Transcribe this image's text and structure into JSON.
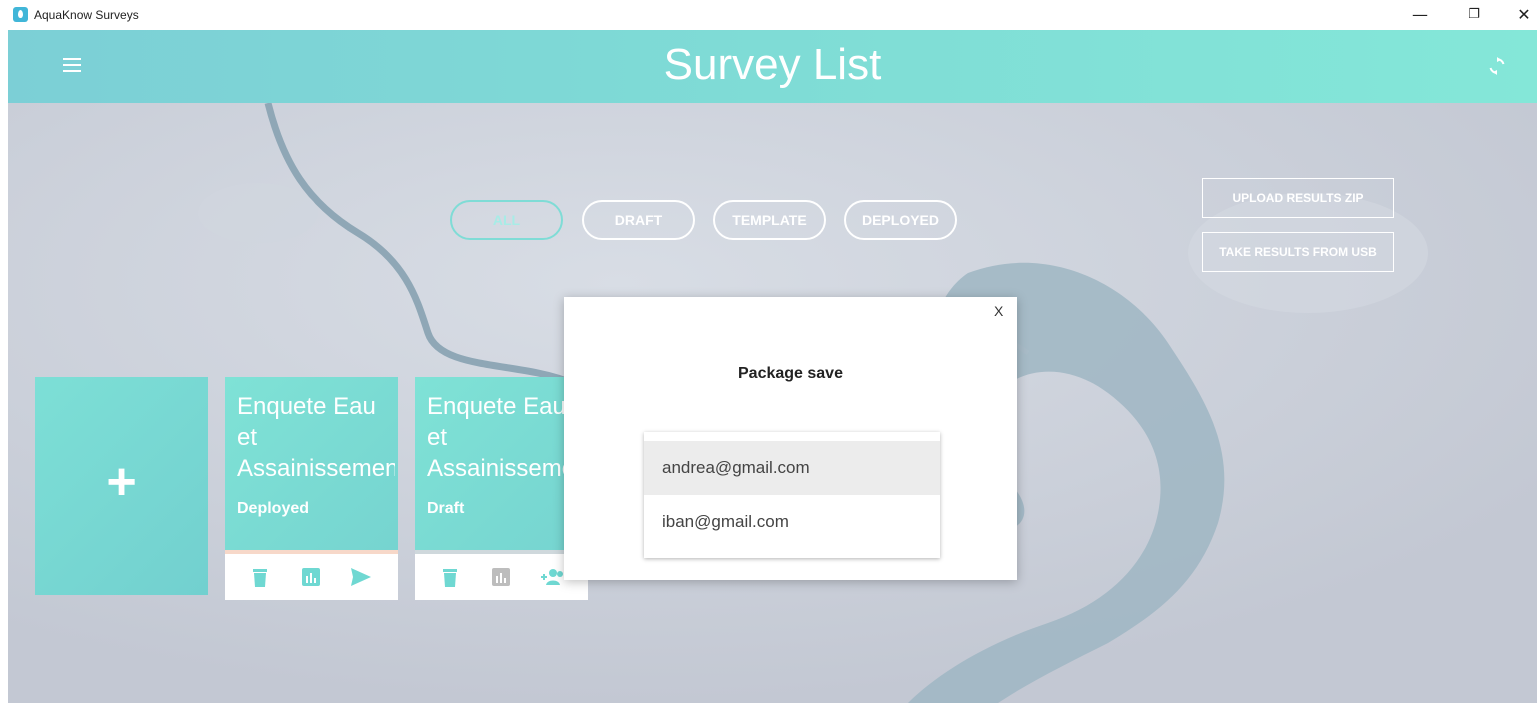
{
  "window": {
    "title": "AquaKnow Surveys",
    "controls": {
      "minimize": "—",
      "restore": "❐",
      "close": "✕"
    }
  },
  "appbar": {
    "title": "Survey List",
    "menu_icon": "hamburger-menu-icon",
    "sync_icon": "sync-icon",
    "color_start": "#7ccfd6",
    "color_end": "#84e7d8"
  },
  "filters": [
    {
      "label": "ALL",
      "active": true
    },
    {
      "label": "DRAFT",
      "active": false
    },
    {
      "label": "TEMPLATE",
      "active": false
    },
    {
      "label": "DEPLOYED",
      "active": false
    }
  ],
  "side_buttons": {
    "upload": "UPLOAD RESULTS ZIP",
    "usb": "TAKE RESULTS FROM USB"
  },
  "add_card": {
    "label": "+"
  },
  "cards": [
    {
      "title": "Enquete Eau et Assainissement",
      "status": "Deployed",
      "actions": [
        "delete-icon",
        "chart-icon",
        "send-icon"
      ]
    },
    {
      "title": "Enquete Eau et Assainissement",
      "status": "Draft",
      "actions": [
        "delete-icon",
        "chart-icon",
        "add-users-icon"
      ]
    }
  ],
  "modal": {
    "close": "X",
    "title": "Package save",
    "users": [
      "andrea@gmail.com",
      "iban@gmail.com"
    ]
  },
  "colors": {
    "accent": "#7fdcd6",
    "card_strip": "#f7d8c9",
    "map_bg": "#c8ccd6",
    "water": "#9fb6c3"
  }
}
